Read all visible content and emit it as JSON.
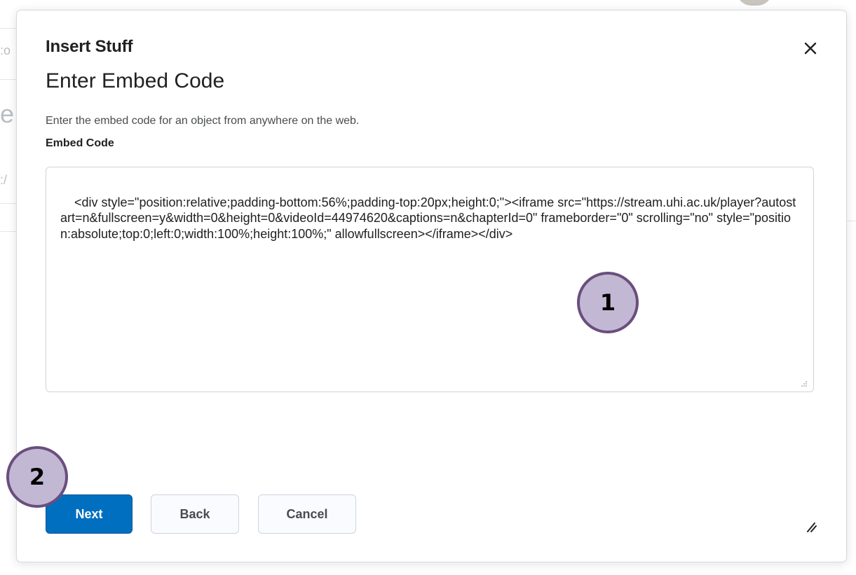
{
  "background": {
    "fragments": [
      ":o",
      "e",
      ":/"
    ]
  },
  "dialog": {
    "title": "Insert Stuff",
    "subtitle": "Enter Embed Code",
    "description": "Enter the embed code for an object from anywhere on the web.",
    "field_label": "Embed Code",
    "embed_code": "<div style=\"position:relative;padding-bottom:56%;padding-top:20px;height:0;\"><iframe src=\"https://stream.uhi.ac.uk/player?autostart=n&fullscreen=y&width=0&height=0&videoId=44974620&captions=n&chapterId=0\" frameborder=\"0\" scrolling=\"no\" style=\"position:absolute;top:0;left:0;width:100%;height:100%;\" allowfullscreen></iframe></div>",
    "close_icon": "close-icon",
    "buttons": {
      "next": "Next",
      "back": "Back",
      "cancel": "Cancel"
    }
  },
  "callouts": {
    "first": "1",
    "second": "2"
  },
  "colors": {
    "primary": "#006fbf",
    "badge_fill": "#c3b8d4",
    "badge_border": "#6a4e7d"
  }
}
